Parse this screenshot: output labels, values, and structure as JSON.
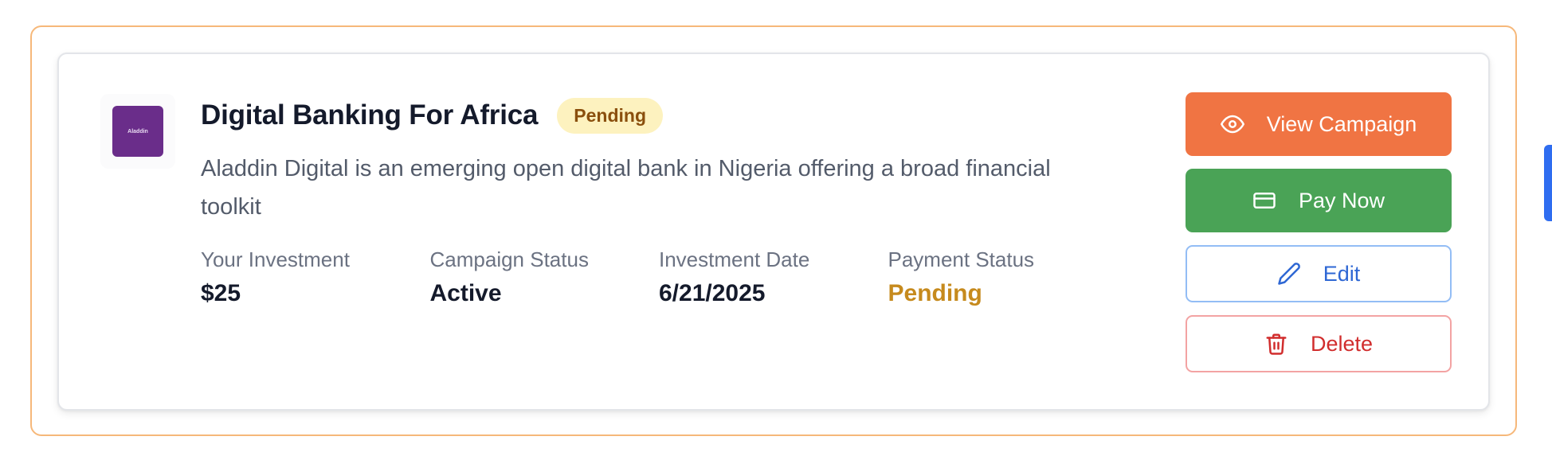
{
  "campaign": {
    "logo_text": "Aladdin",
    "title": "Digital Banking For Africa",
    "badge": "Pending",
    "description": "Aladdin Digital is an emerging open digital bank in Nigeria offering a broad financial toolkit"
  },
  "stats": [
    {
      "label": "Your Investment",
      "value": "$25"
    },
    {
      "label": "Campaign Status",
      "value": "Active"
    },
    {
      "label": "Investment Date",
      "value": "6/21/2025"
    },
    {
      "label": "Payment Status",
      "value": "Pending"
    }
  ],
  "actions": {
    "view": {
      "label": "View Campaign",
      "icon": "eye-icon"
    },
    "pay": {
      "label": "Pay Now",
      "icon": "credit-card-icon"
    },
    "edit": {
      "label": "Edit",
      "icon": "pencil-icon"
    },
    "delete": {
      "label": "Delete",
      "icon": "trash-icon"
    }
  },
  "colors": {
    "accent_orange": "#f07443",
    "pay_green": "#4aa356",
    "edit_blue": "#2e67d4",
    "delete_red": "#d12d2d",
    "pending_amber": "#c68a1d",
    "logo_purple": "#6a2d8a"
  }
}
